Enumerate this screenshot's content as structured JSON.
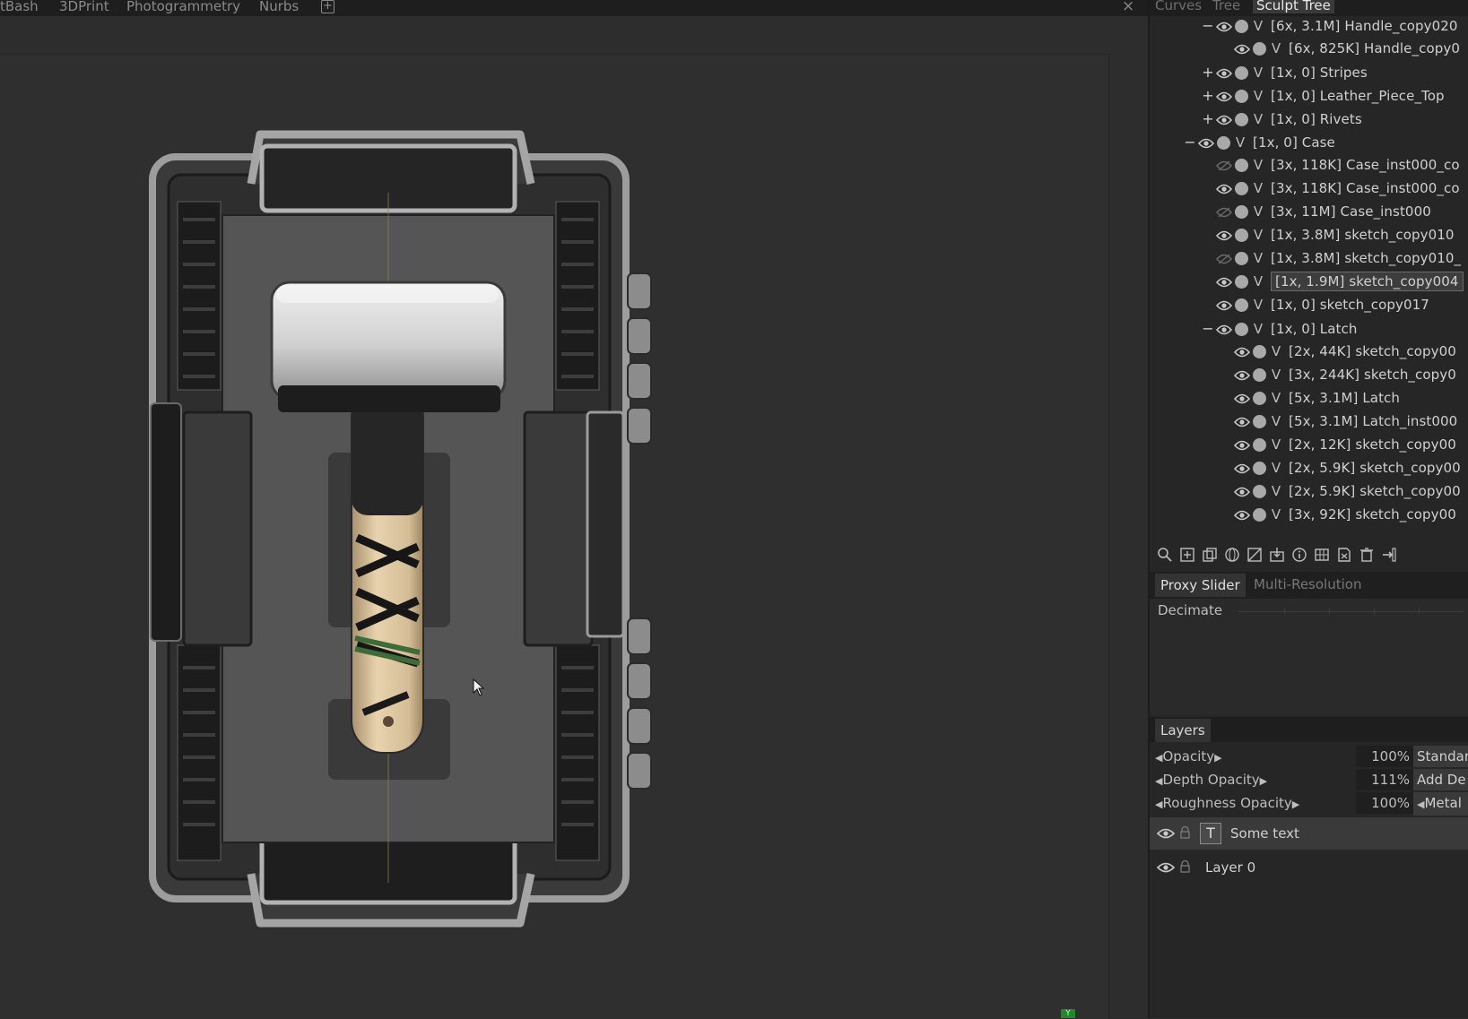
{
  "menu": {
    "tabs": [
      "tBash",
      "3DPrint",
      "Photogrammetry",
      "Nurbs"
    ],
    "add_tab_icon": "plus-square-icon",
    "close_icon": "close-icon"
  },
  "panel": {
    "tabs": [
      "Curves",
      "Tree",
      "Sculpt",
      "Tree"
    ],
    "active_tab": "Sculpt Tree",
    "tree": [
      {
        "toggle": "−",
        "label": "[6x, 3.1M]  Handle_copy020",
        "visible": true
      },
      {
        "toggle": "",
        "label": "[6x, 825K]  Handle_copy0",
        "visible": true
      },
      {
        "toggle": "+",
        "label": "[1x, 0]  Stripes",
        "visible": true
      },
      {
        "toggle": "+",
        "label": "[1x, 0]  Leather_Piece_Top",
        "visible": true
      },
      {
        "toggle": "+",
        "label": "[1x, 0]  Rivets",
        "visible": true
      },
      {
        "toggle": "−",
        "label": "[1x, 0]  Case",
        "visible": true
      },
      {
        "toggle": "",
        "label": "[3x, 118K]  Case_inst000_co",
        "visible": false
      },
      {
        "toggle": "",
        "label": "[3x, 118K]  Case_inst000_co",
        "visible": true
      },
      {
        "toggle": "",
        "label": "[3x, 11M]  Case_inst000",
        "visible": false
      },
      {
        "toggle": "",
        "label": "[1x, 3.8M]  sketch_copy010",
        "visible": true
      },
      {
        "toggle": "",
        "label": "[1x, 3.8M]  sketch_copy010_",
        "visible": false
      },
      {
        "toggle": "",
        "label": "[1x, 1.9M]  sketch_copy004",
        "visible": true,
        "selected": true
      },
      {
        "toggle": "",
        "label": "[1x, 0]  sketch_copy017",
        "visible": true
      },
      {
        "toggle": "−",
        "label": "[1x, 0]  Latch",
        "visible": true
      },
      {
        "toggle": "",
        "label": "[2x, 44K]  sketch_copy00",
        "visible": true
      },
      {
        "toggle": "",
        "label": "[3x, 244K]  sketch_copy0",
        "visible": true
      },
      {
        "toggle": "",
        "label": "[5x, 3.1M]  Latch",
        "visible": true
      },
      {
        "toggle": "",
        "label": "[5x, 3.1M]  Latch_inst000",
        "visible": true
      },
      {
        "toggle": "",
        "label": "[2x, 12K]  sketch_copy00",
        "visible": true
      },
      {
        "toggle": "",
        "label": "[2x, 5.9K]  sketch_copy00",
        "visible": true
      },
      {
        "toggle": "",
        "label": "[2x, 5.9K]  sketch_copy00",
        "visible": true
      },
      {
        "toggle": "",
        "label": "[3x, 92K]  sketch_copy00",
        "visible": true
      }
    ],
    "visibility_column_glyph": "V",
    "toolbar_icons": [
      "search-icon",
      "add-layer-icon",
      "duplicate-icon",
      "sphere-icon",
      "merge-icon",
      "import-icon",
      "info-icon",
      "grid-icon",
      "export-icon",
      "trash-icon",
      "collapse-icon"
    ],
    "proxy": {
      "tabs": [
        "Proxy Slider",
        "Multi-Resolution"
      ],
      "decimate_label": "Decimate"
    },
    "layers": {
      "title": "Layers",
      "props": [
        {
          "label": "Opacity",
          "value": "100%",
          "extra": "Standar"
        },
        {
          "label": "Depth  Opacity",
          "value": "111%",
          "extra": "Add  De"
        },
        {
          "label": "Roughness  Opacity",
          "value": "100%",
          "extra": "Metal"
        }
      ],
      "items": [
        {
          "name": "Some  text",
          "type": "text-layer",
          "selected": true
        },
        {
          "name": "Layer  0",
          "type": "layer",
          "selected": false
        }
      ]
    }
  },
  "viewport": {
    "gizmo_label": "Y"
  },
  "colors": {
    "background": "#2b2b2b",
    "panel": "#262626",
    "hammer_head": "#d9d9d9",
    "handle_wrap": "#e6cfa8",
    "grip_stripe": "#3d6b3a"
  }
}
